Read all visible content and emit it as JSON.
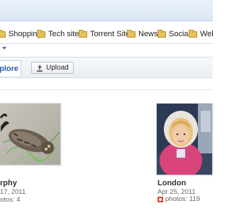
{
  "bookmarks_bar": {
    "items": [
      {
        "label": "Shopping"
      },
      {
        "label": "Tech sites"
      },
      {
        "label": "Torrent Sites"
      },
      {
        "label": "News"
      },
      {
        "label": "Social"
      },
      {
        "label": "Webs"
      }
    ]
  },
  "toolbar": {
    "explore_tab_label": "plore",
    "upload_label": "Upload"
  },
  "albums": [
    {
      "title": "rphy",
      "date": "17, 2011",
      "count": "otos: 4"
    },
    {
      "title": "London",
      "date": "Apr 25, 2011",
      "count": "photos: 119"
    }
  ],
  "colors": {
    "link_blue": "#2a5db0",
    "folder_yellow": "#e8c15a",
    "picasa_red": "#e0453a"
  }
}
